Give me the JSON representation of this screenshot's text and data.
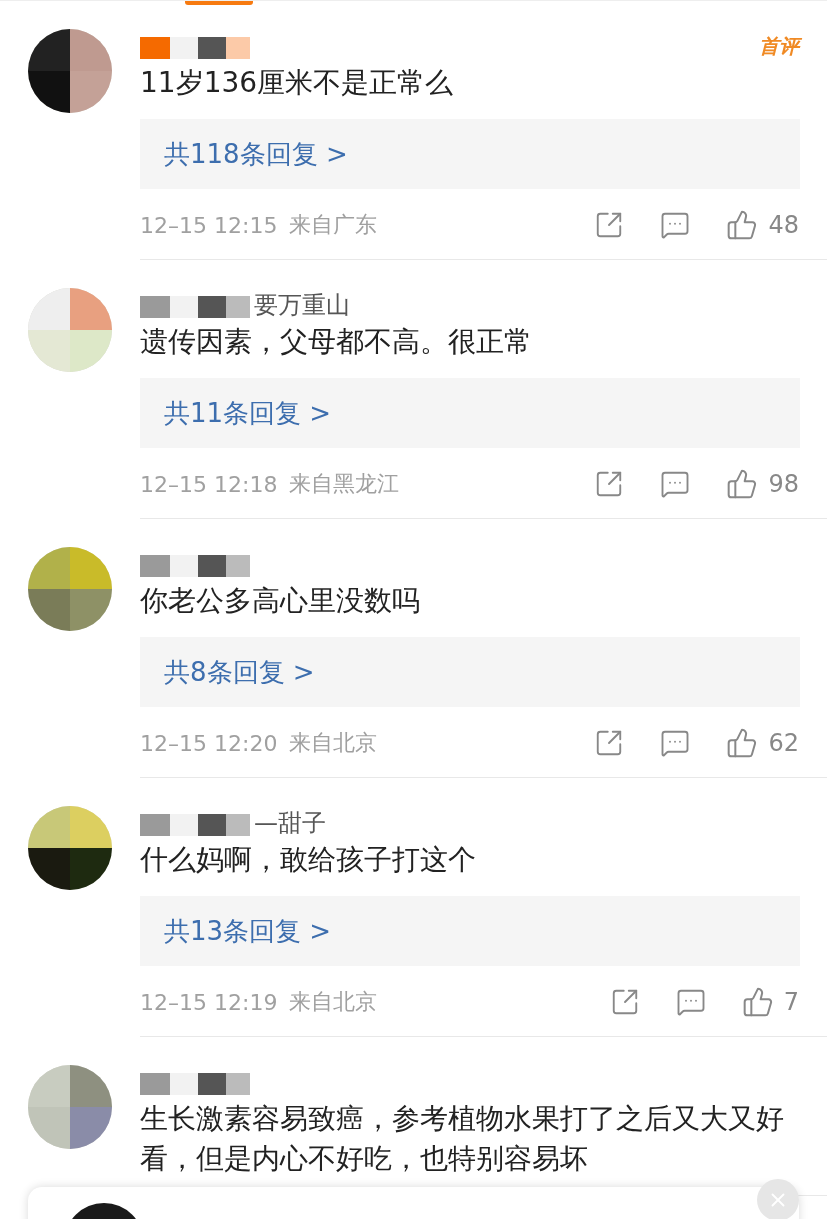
{
  "comments": [
    {
      "badge": "首评",
      "text": "11岁136厘米不是正常么",
      "replies": "共118条回复 >",
      "time": "12–15 12:15",
      "location": "来自广东",
      "likes": "48"
    },
    {
      "name": "要万重山",
      "text": "遗传因素，父母都不高。很正常",
      "replies": "共11条回复 >",
      "time": "12–15 12:18",
      "location": "来自黑龙江",
      "likes": "98"
    },
    {
      "text": "你老公多高心里没数吗",
      "replies": "共8条回复 >",
      "time": "12–15 12:20",
      "location": "来自北京",
      "likes": "62"
    },
    {
      "name": "—甜子",
      "text": "什么妈啊，敢给孩子打这个",
      "replies": "共13条回复 >",
      "time": "12–15 12:19",
      "location": "来自北京",
      "likes": "7"
    },
    {
      "text": "生长激素容易致癌，参考植物水果打了之后又大又好看，但是内心不好吃，也特别容易坏"
    }
  ]
}
